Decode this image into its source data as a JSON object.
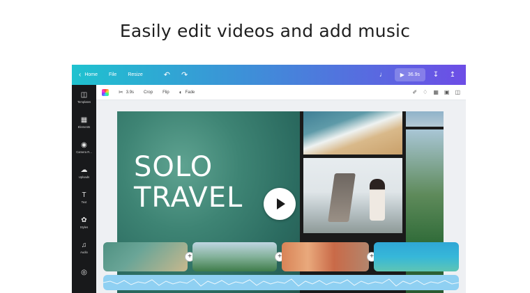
{
  "headline": "Easily edit videos and add music",
  "topbar": {
    "nav": [
      "Home",
      "File",
      "Resize"
    ],
    "present_label": "36.9s"
  },
  "sidebar": {
    "items": [
      {
        "label": "Templates",
        "icon": "templates-icon"
      },
      {
        "label": "Elements",
        "icon": "elements-icon"
      },
      {
        "label": "Camera R...",
        "icon": "camera-icon"
      },
      {
        "label": "Uploads",
        "icon": "upload-icon"
      },
      {
        "label": "Text",
        "icon": "text-icon"
      },
      {
        "label": "Styles",
        "icon": "styles-icon"
      },
      {
        "label": "Audio",
        "icon": "audio-icon"
      }
    ]
  },
  "toolbar": {
    "duration": "3.9s",
    "crop": "Crop",
    "flip": "Flip",
    "fade": "Fade"
  },
  "canvas": {
    "line1": "SOLO",
    "line2": "TRAVEL"
  }
}
